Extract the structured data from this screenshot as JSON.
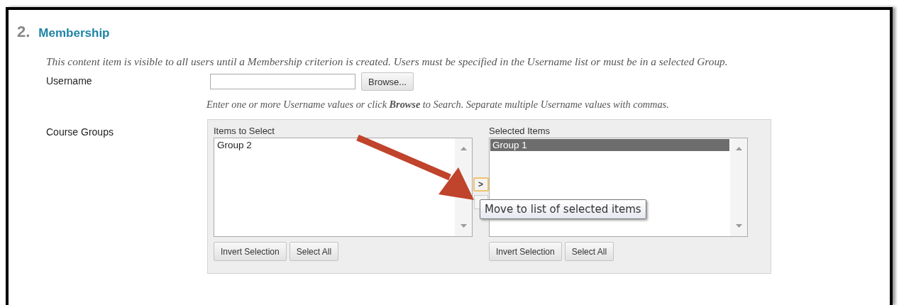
{
  "section": {
    "number": "2.",
    "title": "Membership"
  },
  "description": "This content item is visible to all users until a Membership criterion is created. Users must be specified in the Username list or must be in a selected Group.",
  "username": {
    "label": "Username",
    "browse_button": "Browse...",
    "hint": "Enter one or more Username values or click **Browse** to Search. Separate multiple Username values with commas."
  },
  "course_groups": {
    "label": "Course Groups",
    "available": {
      "heading": "Items to Select",
      "items": [
        {
          "label": "Group 2",
          "selected": false
        }
      ],
      "buttons": [
        "Invert Selection",
        "Select All"
      ]
    },
    "move_button": {
      "label": ">"
    },
    "tooltip": "Move to list of selected items",
    "chosen": {
      "heading": "Selected Items",
      "items": [
        {
          "label": "Group 1",
          "selected": true
        }
      ],
      "buttons": [
        "Invert Selection",
        "Select All"
      ]
    }
  }
}
